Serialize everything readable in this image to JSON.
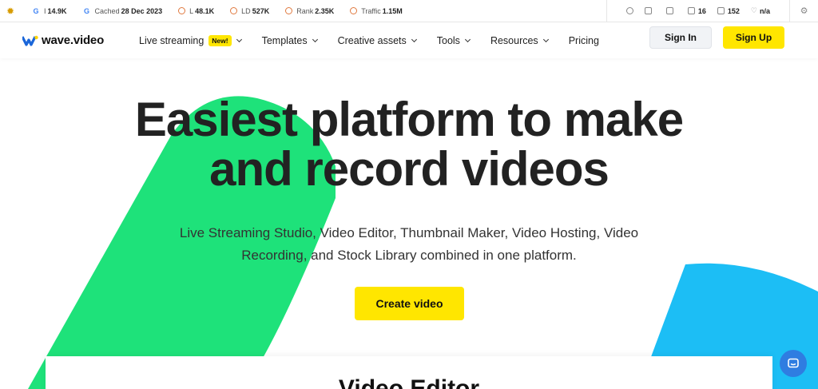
{
  "seo_toolbar": {
    "metrics": [
      {
        "icon": "google-icon",
        "label": "I",
        "value": "14.9K"
      },
      {
        "icon": "google-icon",
        "label": "Cached",
        "value": "28 Dec 2023"
      },
      {
        "icon": "circle-icon",
        "label": "L",
        "value": "48.1K"
      },
      {
        "icon": "circle-icon",
        "label": "LD",
        "value": "527K"
      },
      {
        "icon": "circle-icon",
        "label": "Rank",
        "value": "2.35K"
      },
      {
        "icon": "circle-icon",
        "label": "Traffic",
        "value": "1.15M"
      }
    ],
    "right_items": [
      {
        "icon": "info-icon",
        "value": ""
      },
      {
        "icon": "monitor-icon",
        "value": ""
      },
      {
        "icon": "bookmark-icon",
        "value": ""
      },
      {
        "icon": "external-link-icon",
        "value": "16"
      },
      {
        "icon": "image-icon",
        "value": "152"
      },
      {
        "icon": "diamond-icon",
        "value": "n/a"
      }
    ]
  },
  "nav": {
    "brand": "wave.video",
    "menu": [
      {
        "label": "Live streaming",
        "badge": "New!",
        "dropdown": true
      },
      {
        "label": "Templates",
        "dropdown": true
      },
      {
        "label": "Creative assets",
        "dropdown": true
      },
      {
        "label": "Tools",
        "dropdown": true
      },
      {
        "label": "Resources",
        "dropdown": true
      },
      {
        "label": "Pricing",
        "dropdown": false
      }
    ],
    "sign_in": "Sign In",
    "sign_up": "Sign Up"
  },
  "hero": {
    "headline_line1": "Easiest platform to make",
    "headline_line2": "and record videos",
    "subtitle_line1": "Live Streaming Studio, Video Editor, Thumbnail Maker, Video Hosting, Video",
    "subtitle_line2": "Recording, and Stock Library combined in one platform.",
    "cta": "Create video",
    "section_title": "Video Editor"
  },
  "colors": {
    "accent_yellow": "#ffe600",
    "green_shape": "#1ee27a",
    "blue_shape": "#1cbef5",
    "chat_blue": "#2f7de1"
  }
}
